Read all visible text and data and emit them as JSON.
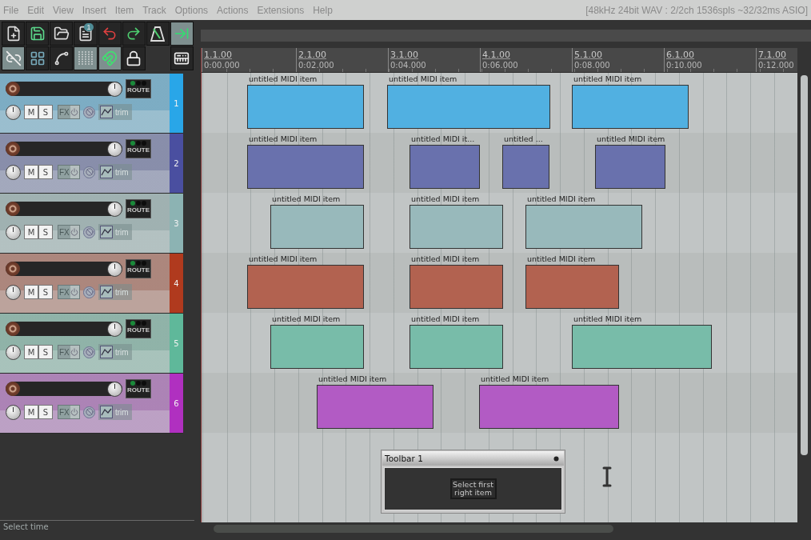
{
  "menu": [
    {
      "label": "File"
    },
    {
      "label": "Edit"
    },
    {
      "label": "View"
    },
    {
      "label": "Insert"
    },
    {
      "label": "Item"
    },
    {
      "label": "Track"
    },
    {
      "label": "Options"
    },
    {
      "label": "Actions"
    },
    {
      "label": "Extensions"
    },
    {
      "label": "Help"
    }
  ],
  "audio_info": "[48kHz 24bit WAV : 2/2ch 1536spls ~32/32ms ASIO]",
  "toolbar": [
    {
      "kind": "new",
      "on": false
    },
    {
      "kind": "save",
      "on": false
    },
    {
      "kind": "open",
      "on": false
    },
    {
      "kind": "info",
      "on": false,
      "badge": "1"
    },
    {
      "kind": "undo",
      "on": false
    },
    {
      "kind": "redo",
      "on": false
    },
    {
      "kind": "metronome",
      "on": false
    },
    {
      "kind": "crossfade",
      "on": true
    },
    {
      "kind": "grid-link",
      "on": true
    },
    {
      "kind": "grid-settings",
      "on": false
    },
    {
      "kind": "envelope",
      "on": false
    },
    {
      "kind": "grid",
      "on": true
    },
    {
      "kind": "ripple",
      "on": true
    },
    {
      "kind": "lock",
      "on": false
    },
    {
      "kind": "piano",
      "on": false
    }
  ],
  "ruler": [
    {
      "bar": "1.1.00",
      "time": "0:00.000"
    },
    {
      "bar": "2.1.00",
      "time": "0:02.000"
    },
    {
      "bar": "3.1.00",
      "time": "0:04.000"
    },
    {
      "bar": "4.1.00",
      "time": "0:06.000"
    },
    {
      "bar": "5.1.00",
      "time": "0:08.000"
    },
    {
      "bar": "6.1.00",
      "time": "0:10.000"
    },
    {
      "bar": "7.1.00",
      "time": "0:12.000"
    }
  ],
  "tracks": [
    {
      "number": "1",
      "color": "#29a6e8",
      "route": "ROUTE",
      "mute": "M",
      "solo": "S",
      "fx": "FX",
      "trim": "trim",
      "items": [
        {
          "label": "untitled MIDI item"
        },
        {
          "label": "untitled MIDI item"
        },
        {
          "label": "untitled MIDI item"
        }
      ]
    },
    {
      "number": "2",
      "color": "#4a4fa0",
      "route": "ROUTE",
      "mute": "M",
      "solo": "S",
      "fx": "FX",
      "trim": "trim",
      "items": [
        {
          "label": "untitled MIDI item"
        },
        {
          "label": "untitled MIDI it..."
        },
        {
          "label": "untitled ..."
        },
        {
          "label": "untitled MIDI item"
        }
      ]
    },
    {
      "number": "3",
      "color": "#8cb3b3",
      "route": "ROUTE",
      "mute": "M",
      "solo": "S",
      "fx": "FX",
      "trim": "trim",
      "items": [
        {
          "label": "untitled MIDI item"
        },
        {
          "label": "untitled MIDI item"
        },
        {
          "label": "untitled MIDI item"
        }
      ]
    },
    {
      "number": "4",
      "color": "#b03a1e",
      "route": "ROUTE",
      "mute": "M",
      "solo": "S",
      "fx": "FX",
      "trim": "trim",
      "items": [
        {
          "label": "untitled MIDI item"
        },
        {
          "label": "untitled MIDI item"
        },
        {
          "label": "untitled MIDI item"
        }
      ]
    },
    {
      "number": "5",
      "color": "#5fb89a",
      "route": "ROUTE",
      "mute": "M",
      "solo": "S",
      "fx": "FX",
      "trim": "trim",
      "items": [
        {
          "label": "untitled MIDI item"
        },
        {
          "label": "untitled MIDI item"
        },
        {
          "label": "untitled MIDI item"
        }
      ]
    },
    {
      "number": "6",
      "color": "#b030c0",
      "route": "ROUTE",
      "mute": "M",
      "solo": "S",
      "fx": "FX",
      "trim": "trim",
      "items": [
        {
          "label": "untitled MIDI item"
        },
        {
          "label": "untitled MIDI item"
        }
      ]
    }
  ],
  "toolbar_window": {
    "title": "Toolbar 1",
    "button": "Select first right item"
  },
  "status_bar": "Select time"
}
